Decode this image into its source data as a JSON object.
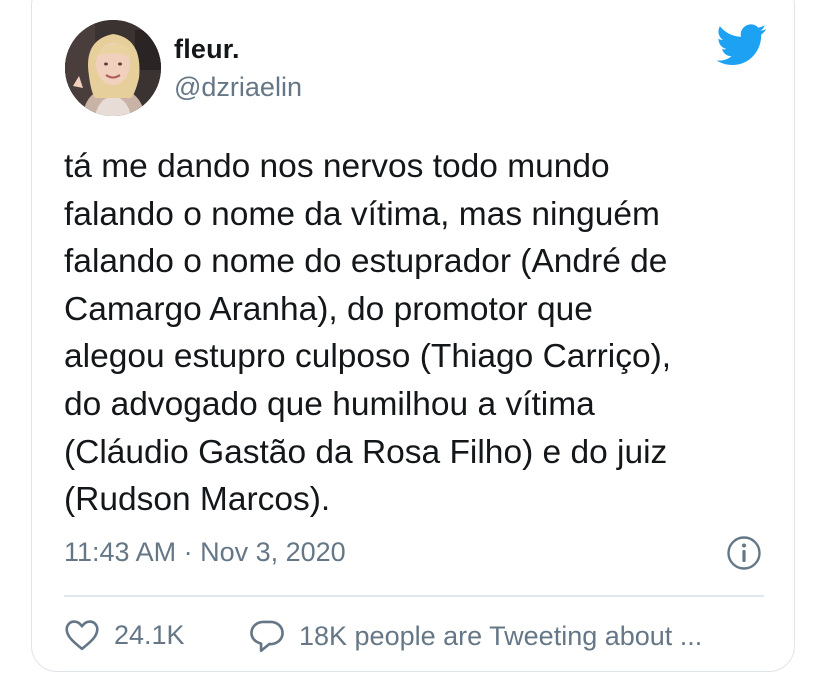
{
  "user": {
    "display_name": "fleur.",
    "handle": "@dzriaelin",
    "avatar": "avatar-photo"
  },
  "icons": {
    "brand": "twitter-bird-icon",
    "info": "info-icon",
    "like": "heart-icon",
    "reply": "speech-bubble-icon"
  },
  "colors": {
    "brand_blue": "#1da1f2",
    "text": "#14171a",
    "muted": "#657786",
    "border": "#e1e8ed"
  },
  "tweet": {
    "lines": [
      "tá me dando nos nervos todo mundo",
      "falando o nome da vítima, mas ninguém",
      "falando o nome do estuprador (André de",
      "Camargo Aranha), do promotor que",
      "alegou estupro culposo (Thiago Carriço),",
      "do advogado que humilhou a vítima",
      "(Cláudio Gastão da Rosa Filho) e do juiz",
      "(Rudson Marcos)."
    ],
    "timestamp": "11:43 AM · Nov 3, 2020"
  },
  "actions": {
    "likes": "24.1K",
    "conversation": "18K people are Tweeting about ..."
  }
}
